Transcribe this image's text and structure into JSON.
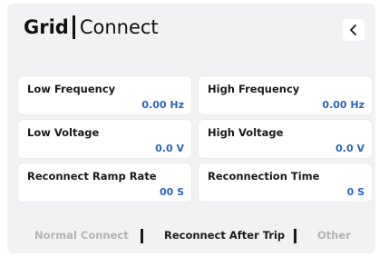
{
  "header": {
    "title_bold": "Grid",
    "title_light": "Connect",
    "back_icon": "chevron-left-icon"
  },
  "fields": [
    {
      "label": "Low Frequency",
      "value": "0.00 Hz"
    },
    {
      "label": "High Frequency",
      "value": "0.00 Hz"
    },
    {
      "label": "Low Voltage",
      "value": "0.0 V"
    },
    {
      "label": "High Voltage",
      "value": "0.0 V"
    },
    {
      "label": "Reconnect Ramp Rate",
      "value": "00 S"
    },
    {
      "label": "Reconnection Time",
      "value": "0 S"
    }
  ],
  "tabs": [
    {
      "label": "Normal Connect",
      "active": false
    },
    {
      "label": "Reconnect After Trip",
      "active": true
    },
    {
      "label": "Other",
      "active": false
    }
  ],
  "colors": {
    "background": "#f2f2f4",
    "card": "#ffffff",
    "value": "#2a66b8",
    "tab_inactive": "#b3b3b8",
    "tab_active": "#1a1a1a"
  }
}
